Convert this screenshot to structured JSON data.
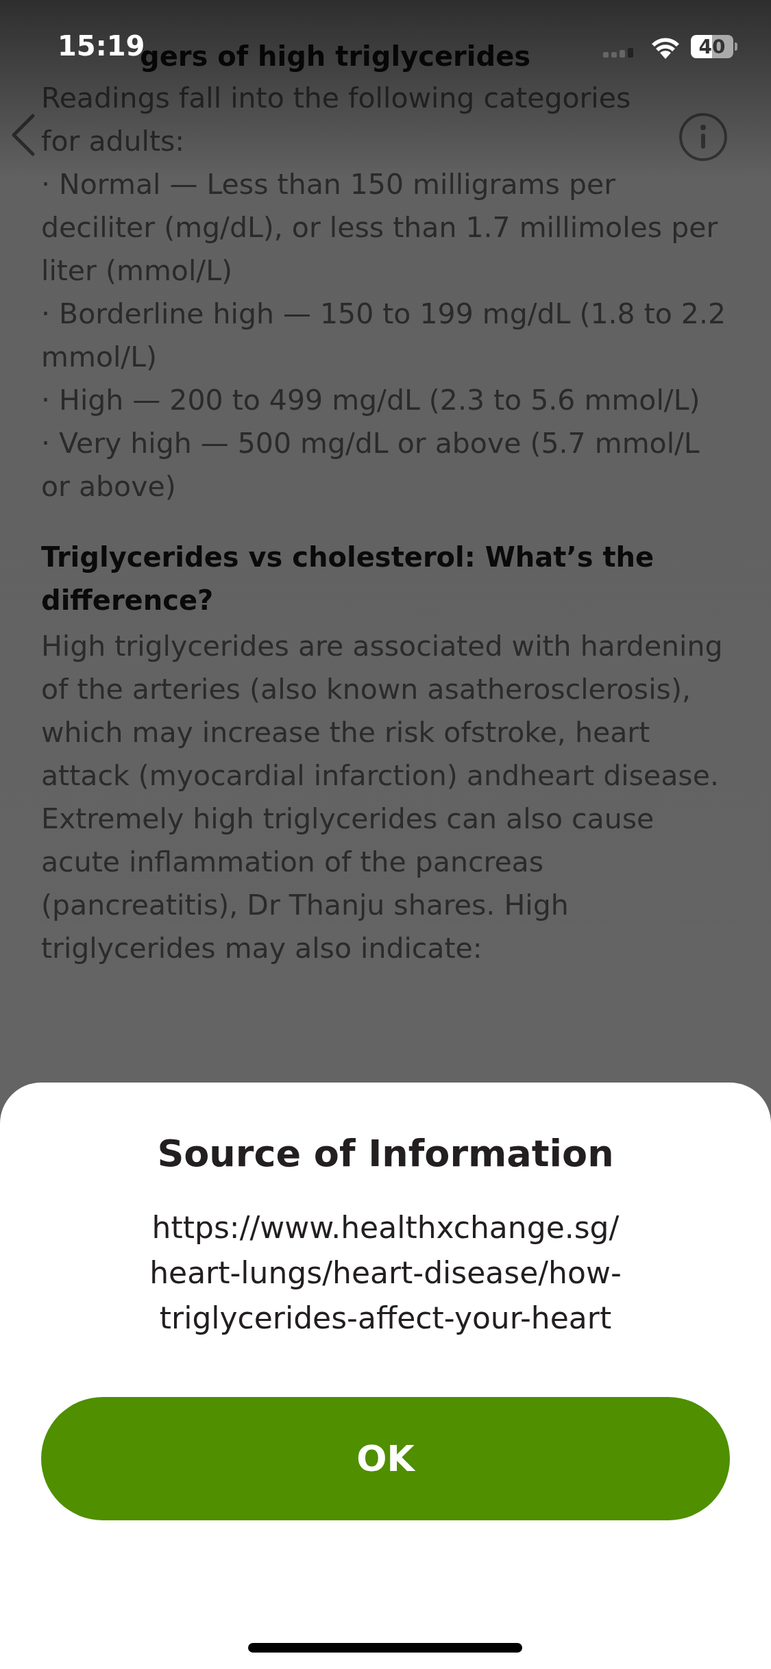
{
  "status_bar": {
    "time": "15:19",
    "battery": "40"
  },
  "article": {
    "title": "gers of high triglycerides",
    "intro": "Readings fall into the following categories for adults:",
    "bullets": [
      "· Normal — Less than 150 milligrams per deciliter (mg/dL), or less than 1.7 millimoles per liter (mmol/L)",
      "· Borderline high — 150 to 199 mg/dL (1.8 to 2.2 mmol/L)",
      "· High — 200 to 499 mg/dL (2.3 to 5.6 mmol/L)",
      "· Very high — 500 mg/dL or above (5.7 mmol/L or above)"
    ],
    "heading": "Triglycerides vs cholesterol: What’s the difference?",
    "paragraph": "High triglycerides are associated with hardening of the arteries (also known asatherosclerosis), which may increase the risk ofstroke, heart attack (myocardial infarction) andheart disease. Extremely high triglycerides can also cause acute inflammation of the pancreas (pancreatitis), Dr Thanju shares. High triglycerides may also indicate:"
  },
  "sheet": {
    "title": "Source of Information",
    "url": "https://www.healthxchange.sg/heart-lungs/heart-disease/how-triglycerides-affect-your-heart",
    "button": "OK"
  }
}
